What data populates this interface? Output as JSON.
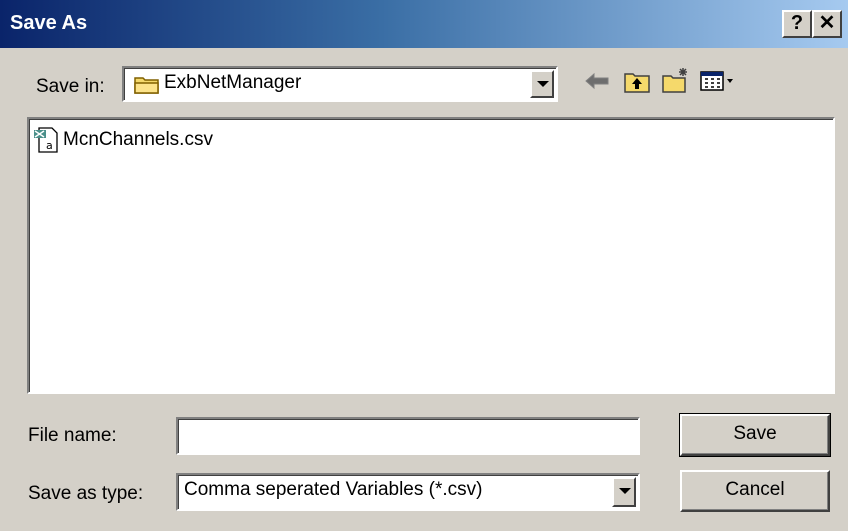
{
  "window": {
    "title": "Save As",
    "help_label": "?",
    "close_label": "✕"
  },
  "toolbar": {
    "save_in_label": "Save in:",
    "save_in_value": "ExbNetManager",
    "icons": [
      "back-arrow-icon",
      "up-folder-icon",
      "new-folder-icon",
      "view-menu-icon"
    ]
  },
  "files": [
    {
      "name": "McnChannels.csv",
      "icon": "csv-file-icon"
    }
  ],
  "form": {
    "file_name_label": "File name:",
    "file_name_value": "",
    "save_as_type_label": "Save as type:",
    "save_as_type_value": "Comma seperated Variables (*.csv)"
  },
  "buttons": {
    "save": "Save",
    "cancel": "Cancel"
  },
  "colors": {
    "title_start": "#0a246a",
    "title_end": "#a6caf0",
    "face": "#d4d0c8"
  }
}
